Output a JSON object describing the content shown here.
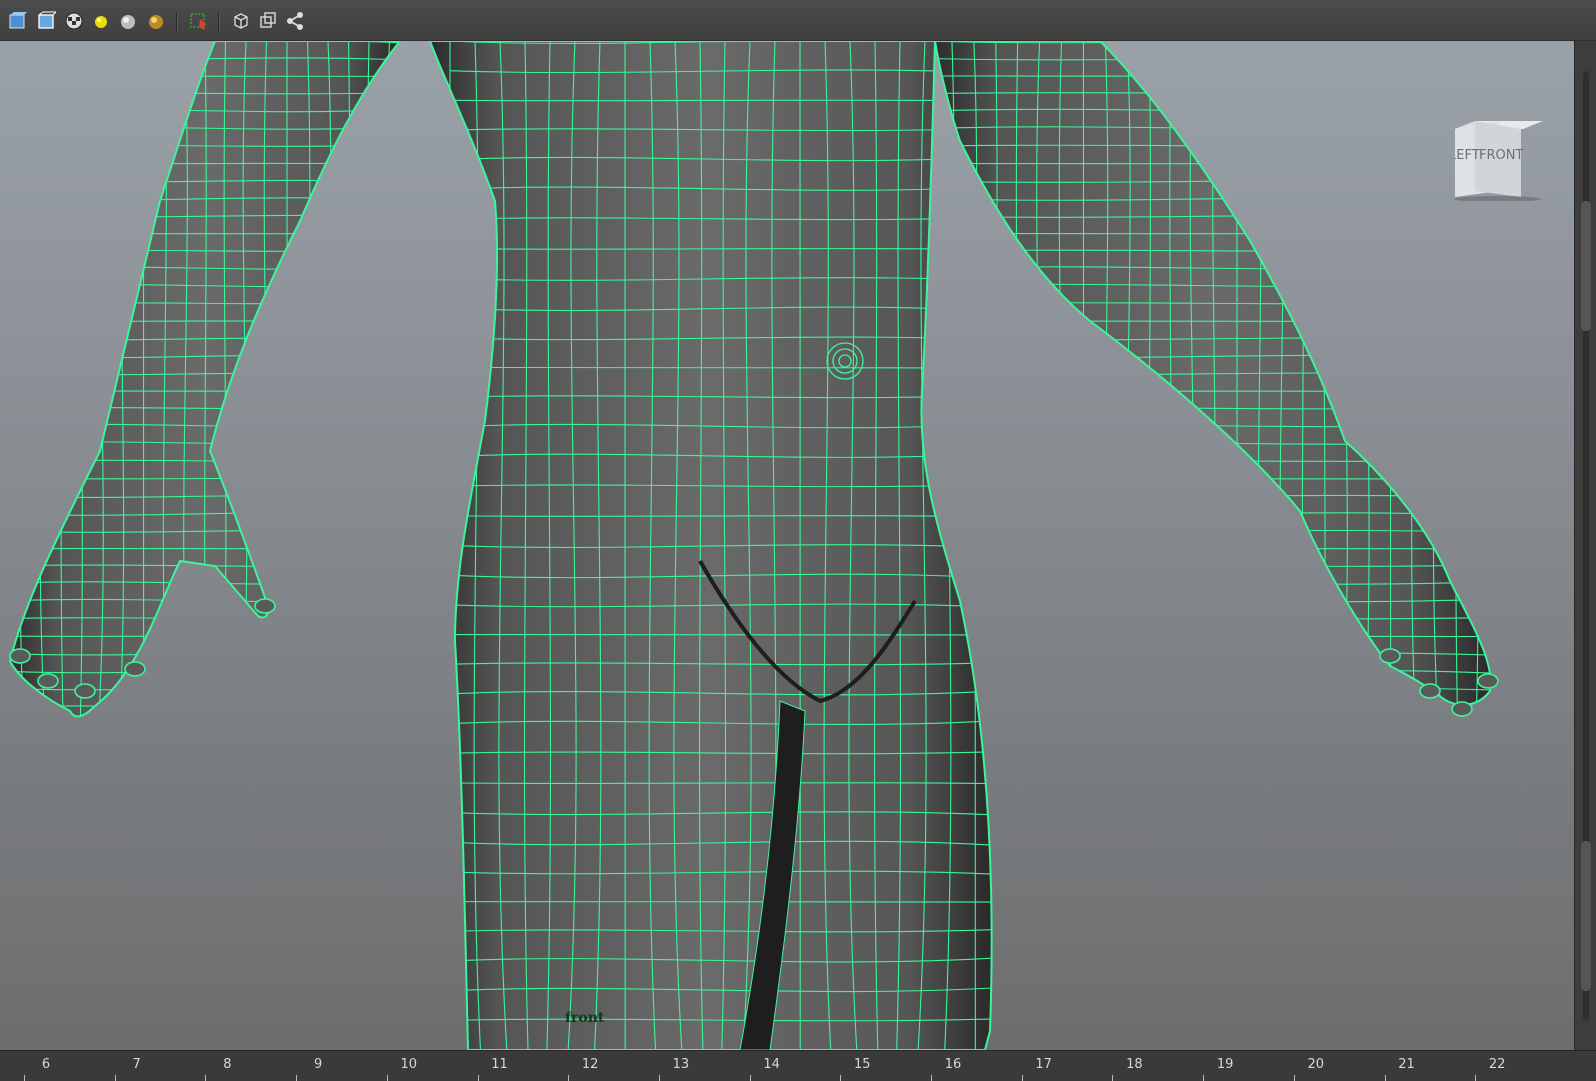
{
  "toolbar": {
    "buttons": [
      {
        "name": "smooth-shade-icon"
      },
      {
        "name": "wireframe-on-shaded-icon"
      },
      {
        "name": "texture-checker-icon"
      },
      {
        "name": "default-light-icon"
      },
      {
        "name": "use-all-lights-icon"
      },
      {
        "name": "shadows-icon"
      },
      {
        "name": "select-camera-icon"
      },
      {
        "name": "isolate-select-icon"
      },
      {
        "name": "xray-icon"
      },
      {
        "name": "share-icon"
      }
    ],
    "colors": {
      "background": "#444444",
      "icon_blue": "#5a9ad8",
      "light_yellow": "#e8e000"
    }
  },
  "viewport": {
    "camera_label": "front",
    "wire_color": "#3cf59a",
    "viewcube": {
      "left_label": "LEFT",
      "front_label": "FRONT"
    }
  },
  "timeline": {
    "ticks": [
      "6",
      "7",
      "8",
      "9",
      "10",
      "11",
      "12",
      "13",
      "14",
      "15",
      "16",
      "17",
      "18",
      "19",
      "20",
      "21",
      "22"
    ]
  }
}
